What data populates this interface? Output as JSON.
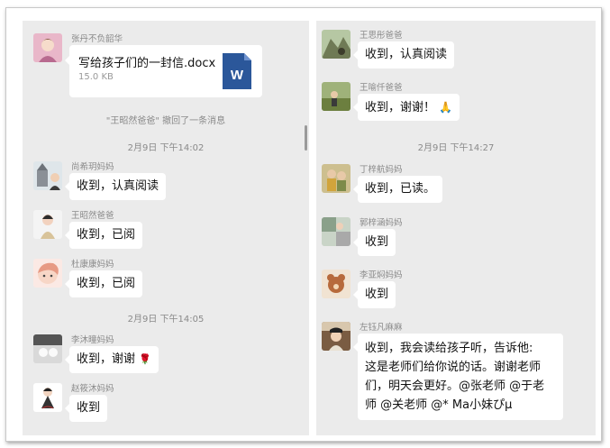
{
  "left_panel": {
    "file_message": {
      "sender": "张丹不负韶华",
      "file_name": "写给孩子们的一封信.docx",
      "file_size": "15.0 KB",
      "file_icon": "word-doc-icon",
      "file_icon_letter": "W"
    },
    "recall_notice": "\"王昭然爸爸\" 撤回了一条消息",
    "timestamp_1": "2月9日 下午14:02",
    "messages_1": [
      {
        "sender": "尚希玥妈妈",
        "text": "收到，认真阅读"
      },
      {
        "sender": "王昭然爸爸",
        "text": "收到，已阅"
      },
      {
        "sender": "杜康康妈妈",
        "text": "收到，已阅"
      }
    ],
    "timestamp_2": "2月9日 下午14:05",
    "messages_2": [
      {
        "sender": "李沐曈妈妈",
        "text": "收到，谢谢",
        "emoji": "🌹"
      },
      {
        "sender": "赵筱沐妈妈",
        "text": "收到"
      }
    ]
  },
  "right_panel": {
    "messages_1": [
      {
        "sender": "王思彤爸爸",
        "text": "收到，认真阅读"
      },
      {
        "sender": "王喻仟爸爸",
        "text": "收到，谢谢！",
        "emoji": "🙏"
      }
    ],
    "timestamp_1": "2月9日 下午14:27",
    "messages_2": [
      {
        "sender": "丁梓航妈妈",
        "text": "收到，已读。"
      },
      {
        "sender": "郭梓涵妈妈",
        "text": "收到"
      },
      {
        "sender": "李亚焖妈妈",
        "text": "收到"
      }
    ],
    "long_message": {
      "sender": "左钰凡麻麻",
      "lines": [
        "收到，我会读给孩子听，告诉他:",
        "这是老师们给你说的话。谢谢老师",
        "们，明天会更好。@张老师 @于老",
        "师 @关老师 @* Ma小妹ぴµ"
      ]
    }
  },
  "colors": {
    "panel_bg": "#ebebeb",
    "bubble_bg": "#ffffff",
    "meta_text": "#8a8a8a",
    "word_blue": "#2b579a"
  }
}
